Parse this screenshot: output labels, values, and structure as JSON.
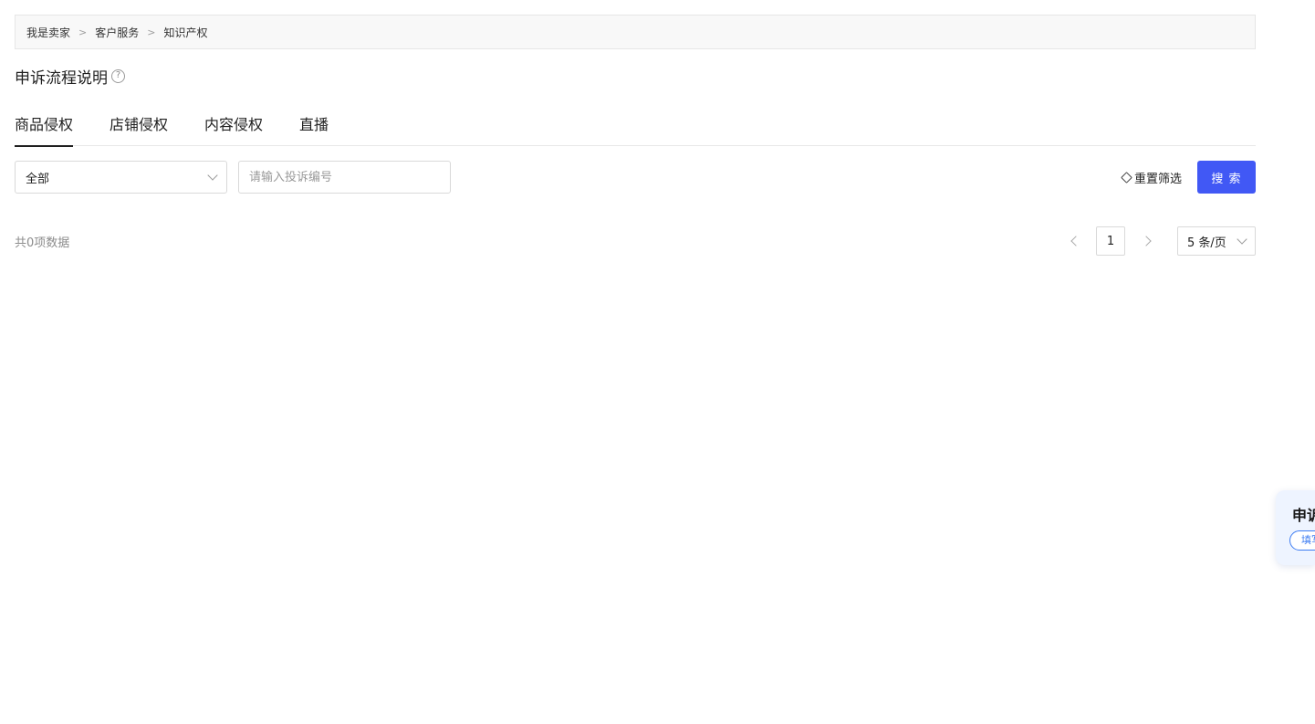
{
  "breadcrumb": {
    "items": [
      "我是卖家",
      "客户服务",
      "知识产权"
    ],
    "separator": ">"
  },
  "page": {
    "title": "申诉流程说明",
    "help_icon": "question-circle-icon"
  },
  "tabs": [
    {
      "label": "商品侵权",
      "active": true
    },
    {
      "label": "店铺侵权",
      "active": false
    },
    {
      "label": "内容侵权",
      "active": false
    },
    {
      "label": "直播",
      "active": false
    }
  ],
  "filters": {
    "select_value": "全部",
    "search_placeholder": "请输入投诉编号",
    "reset_label": "重置筛选",
    "search_button_label": "搜 索"
  },
  "results": {
    "total_label": "共0项数据"
  },
  "pagination": {
    "current_page": "1",
    "page_size_label": "5 条/页"
  },
  "float_card": {
    "title": "申诉",
    "button_label": "填写"
  },
  "colors": {
    "accent": "#4158f5",
    "float_card_bg": "#eef4ff",
    "float_button_border": "#3d7cf2"
  }
}
